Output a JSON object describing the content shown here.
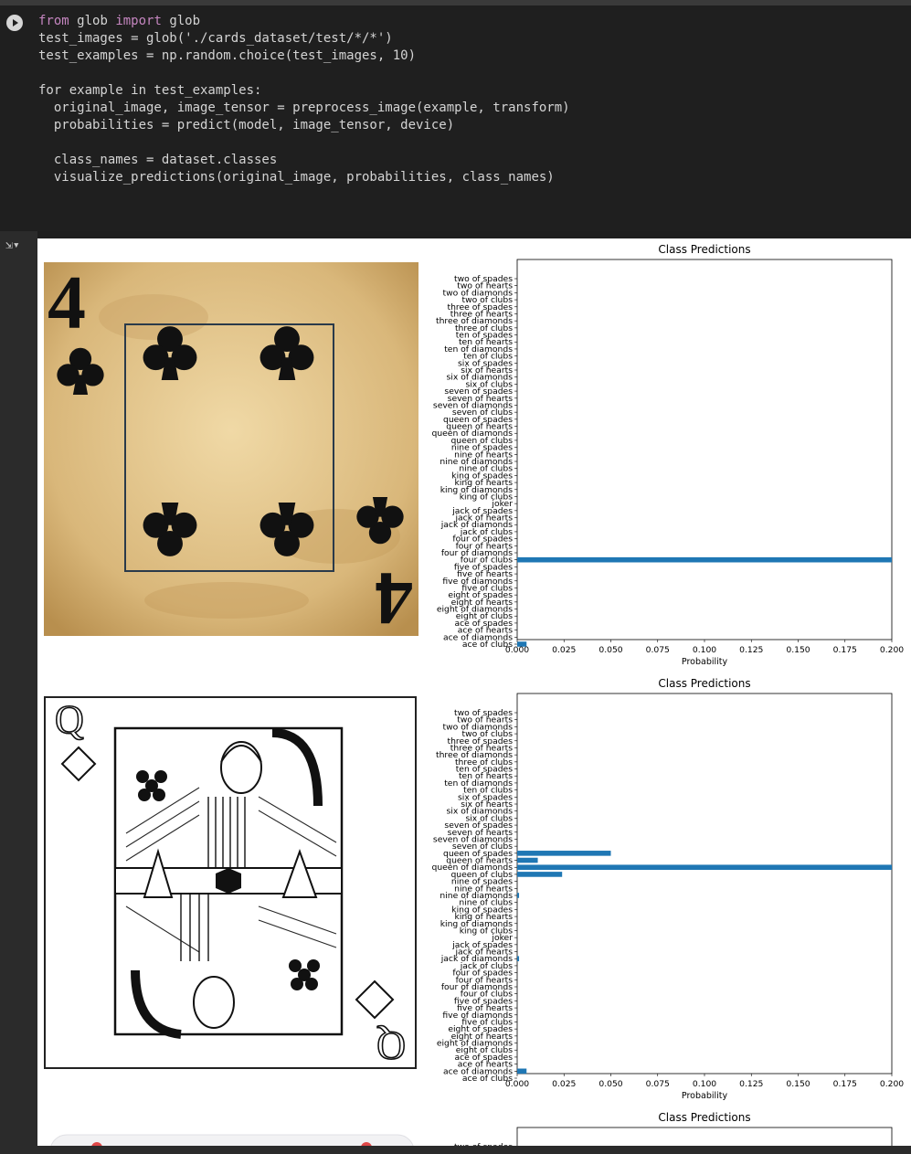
{
  "code": {
    "lines": [
      "from glob import glob",
      "test_images = glob('./cards_dataset/test/*/*')",
      "test_examples = np.random.choice(test_images, 10)",
      "",
      "for example in test_examples:",
      "  original_image, image_tensor = preprocess_image(example, transform)",
      "  probabilities = predict(model, image_tensor, device)",
      "",
      "  class_names = dataset.classes",
      "  visualize_predictions(original_image, probabilities, class_names)"
    ]
  },
  "colors": {
    "bar": "#1f77b4",
    "editor_bg": "#1f1f1f",
    "output_bg": "#ffffff"
  },
  "icons": {
    "run": "play-circle-icon",
    "output": "output-toggle-icon"
  },
  "chart_data": [
    {
      "type": "bar",
      "orientation": "horizontal",
      "title": "Class Predictions",
      "xlabel": "Probability",
      "xlim": [
        0,
        0.2
      ],
      "xticks": [
        "0.000",
        "0.025",
        "0.050",
        "0.075",
        "0.100",
        "0.125",
        "0.150",
        "0.175",
        "0.200"
      ],
      "categories": [
        "two of spades",
        "two of hearts",
        "two of diamonds",
        "two of clubs",
        "three of spades",
        "three of hearts",
        "three of diamonds",
        "three of clubs",
        "ten of spades",
        "ten of hearts",
        "ten of diamonds",
        "ten of clubs",
        "six of spades",
        "six of hearts",
        "six of diamonds",
        "six of clubs",
        "seven of spades",
        "seven of hearts",
        "seven of diamonds",
        "seven of clubs",
        "queen of spades",
        "queen of hearts",
        "queen of diamonds",
        "queen of clubs",
        "nine of spades",
        "nine of hearts",
        "nine of diamonds",
        "nine of clubs",
        "king of spades",
        "king of hearts",
        "king of diamonds",
        "king of clubs",
        "joker",
        "jack of spades",
        "jack of hearts",
        "jack of diamonds",
        "jack of clubs",
        "four of spades",
        "four of hearts",
        "four of diamonds",
        "four of clubs",
        "five of spades",
        "five of hearts",
        "five of diamonds",
        "five of clubs",
        "eight of spades",
        "eight of hearts",
        "eight of diamonds",
        "eight of clubs",
        "ace of spades",
        "ace of hearts",
        "ace of diamonds",
        "ace of clubs"
      ],
      "values": [
        0,
        0,
        0,
        0,
        0,
        0,
        0,
        0,
        0,
        0,
        0,
        0,
        0,
        0,
        0,
        0,
        0,
        0,
        0,
        0,
        0,
        0,
        0,
        0,
        0,
        0,
        0,
        0,
        0,
        0,
        0,
        0,
        0,
        0,
        0,
        0,
        0,
        0,
        0,
        0,
        0.95,
        0,
        0,
        0,
        0,
        0,
        0,
        0,
        0,
        0,
        0,
        0,
        0.005
      ]
    },
    {
      "type": "bar",
      "orientation": "horizontal",
      "title": "Class Predictions",
      "xlabel": "Probability",
      "xlim": [
        0,
        0.2
      ],
      "xticks": [
        "0.000",
        "0.025",
        "0.050",
        "0.075",
        "0.100",
        "0.125",
        "0.150",
        "0.175",
        "0.200"
      ],
      "categories": [
        "two of spades",
        "two of hearts",
        "two of diamonds",
        "two of clubs",
        "three of spades",
        "three of hearts",
        "three of diamonds",
        "three of clubs",
        "ten of spades",
        "ten of hearts",
        "ten of diamonds",
        "ten of clubs",
        "six of spades",
        "six of hearts",
        "six of diamonds",
        "six of clubs",
        "seven of spades",
        "seven of hearts",
        "seven of diamonds",
        "seven of clubs",
        "queen of spades",
        "queen of hearts",
        "queen of diamonds",
        "queen of clubs",
        "nine of spades",
        "nine of hearts",
        "nine of diamonds",
        "nine of clubs",
        "king of spades",
        "king of hearts",
        "king of diamonds",
        "king of clubs",
        "joker",
        "jack of spades",
        "jack of hearts",
        "jack of diamonds",
        "jack of clubs",
        "four of spades",
        "four of hearts",
        "four of diamonds",
        "four of clubs",
        "five of spades",
        "five of hearts",
        "five of diamonds",
        "five of clubs",
        "eight of spades",
        "eight of hearts",
        "eight of diamonds",
        "eight of clubs",
        "ace of spades",
        "ace of hearts",
        "ace of diamonds",
        "ace of clubs"
      ],
      "values": [
        0,
        0,
        0,
        0,
        0,
        0,
        0,
        0,
        0,
        0,
        0,
        0,
        0,
        0,
        0,
        0,
        0,
        0,
        0,
        0,
        0.05,
        0.011,
        0.87,
        0.024,
        0,
        0,
        0.001,
        0,
        0,
        0,
        0,
        0,
        0,
        0,
        0,
        0.001,
        0,
        0,
        0,
        0,
        0,
        0,
        0,
        0,
        0,
        0,
        0,
        0,
        0,
        0,
        0,
        0.005,
        0
      ]
    },
    {
      "type": "bar",
      "orientation": "horizontal",
      "title": "Class Predictions",
      "categories": [
        "two of spades"
      ],
      "values": []
    }
  ],
  "cards": [
    {
      "rank_label": "4",
      "suit_symbol": "♣"
    },
    {
      "rank_label": "Q",
      "suit_symbol": "◇"
    }
  ]
}
